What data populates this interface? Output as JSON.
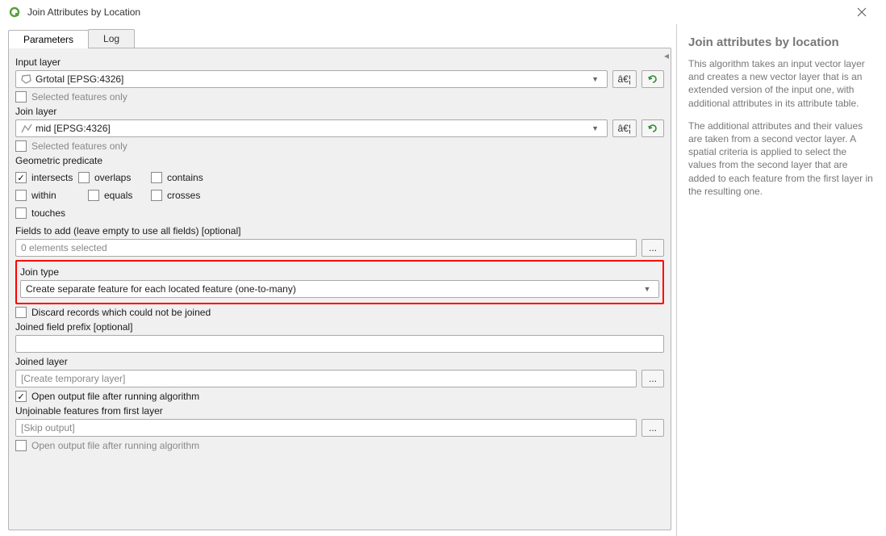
{
  "window": {
    "title": "Join Attributes by Location"
  },
  "tabs": {
    "parameters": "Parameters",
    "log": "Log",
    "active": "parameters"
  },
  "input_layer": {
    "label": "Input layer",
    "value": "Grtotal [EPSG:4326]",
    "browse": "â€¦",
    "selected_only": "Selected features only",
    "selected_only_checked": false
  },
  "join_layer": {
    "label": "Join layer",
    "value": "mid [EPSG:4326]",
    "browse": "â€¦",
    "selected_only": "Selected features only",
    "selected_only_checked": false
  },
  "predicate": {
    "label": "Geometric predicate",
    "items": {
      "intersects": {
        "label": "intersects",
        "checked": true
      },
      "overlaps": {
        "label": "overlaps",
        "checked": false
      },
      "contains": {
        "label": "contains",
        "checked": false
      },
      "within": {
        "label": "within",
        "checked": false
      },
      "equals": {
        "label": "equals",
        "checked": false
      },
      "crosses": {
        "label": "crosses",
        "checked": false
      },
      "touches": {
        "label": "touches",
        "checked": false
      }
    }
  },
  "fields_to_add": {
    "label": "Fields to add (leave empty to use all fields) [optional]",
    "value": "0 elements selected",
    "browse": "..."
  },
  "join_type": {
    "label": "Join type",
    "value": "Create separate feature for each located feature (one-to-many)"
  },
  "discard": {
    "label": "Discard records which could not be joined",
    "checked": false
  },
  "prefix": {
    "label": "Joined field prefix [optional]",
    "value": ""
  },
  "joined_layer": {
    "label": "Joined layer",
    "placeholder": "[Create temporary layer]",
    "browse": "...",
    "open_after": "Open output file after running algorithm",
    "open_after_checked": true
  },
  "unjoinable": {
    "label": "Unjoinable features from first layer",
    "placeholder": "[Skip output]",
    "browse": "...",
    "open_after": "Open output file after running algorithm",
    "open_after_checked": false
  },
  "help": {
    "title": "Join attributes by location",
    "p1": "This algorithm takes an input vector layer and creates a new vector layer that is an extended version of the input one, with additional attributes in its attribute table.",
    "p2": "The additional attributes and their values are taken from a second vector layer. A spatial criteria is applied to select the values from the second layer that are added to each feature from the first layer in the resulting one."
  }
}
